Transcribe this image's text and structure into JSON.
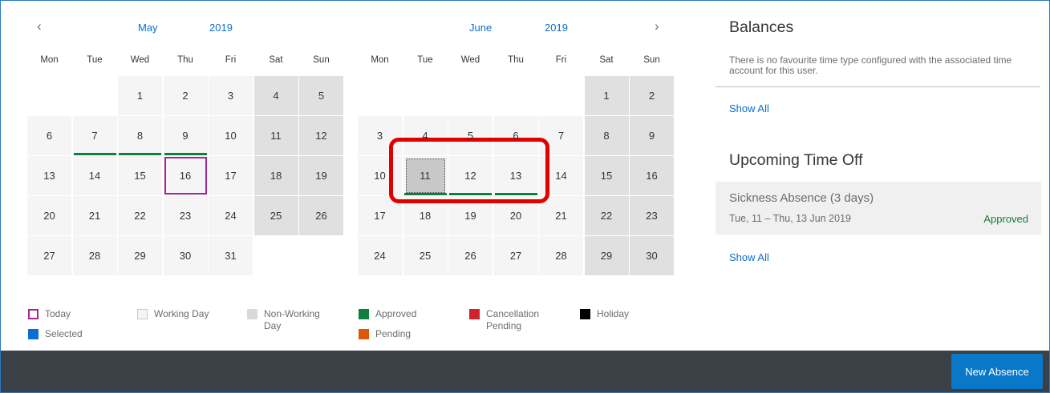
{
  "calendar_left": {
    "prev_icon": "chevron-left-icon",
    "month": "May",
    "year": "2019",
    "weekdays": [
      "Mon",
      "Tue",
      "Wed",
      "Thu",
      "Fri",
      "Sat",
      "Sun"
    ],
    "days": [
      {
        "n": "1",
        "type": "work"
      },
      {
        "n": "2",
        "type": "work"
      },
      {
        "n": "3",
        "type": "work"
      },
      {
        "n": "4",
        "type": "nonwork"
      },
      {
        "n": "5",
        "type": "nonwork"
      },
      {
        "n": "6",
        "type": "work"
      },
      {
        "n": "7",
        "type": "work",
        "status": "approved"
      },
      {
        "n": "8",
        "type": "work",
        "status": "approved"
      },
      {
        "n": "9",
        "type": "work",
        "status": "approved"
      },
      {
        "n": "10",
        "type": "work"
      },
      {
        "n": "11",
        "type": "nonwork"
      },
      {
        "n": "12",
        "type": "nonwork"
      },
      {
        "n": "13",
        "type": "work"
      },
      {
        "n": "14",
        "type": "work"
      },
      {
        "n": "15",
        "type": "work"
      },
      {
        "n": "16",
        "type": "work",
        "today": true
      },
      {
        "n": "17",
        "type": "work"
      },
      {
        "n": "18",
        "type": "nonwork"
      },
      {
        "n": "19",
        "type": "nonwork"
      },
      {
        "n": "20",
        "type": "work"
      },
      {
        "n": "21",
        "type": "work"
      },
      {
        "n": "22",
        "type": "work"
      },
      {
        "n": "23",
        "type": "work"
      },
      {
        "n": "24",
        "type": "work"
      },
      {
        "n": "25",
        "type": "nonwork"
      },
      {
        "n": "26",
        "type": "nonwork"
      },
      {
        "n": "27",
        "type": "work"
      },
      {
        "n": "28",
        "type": "work"
      },
      {
        "n": "29",
        "type": "work"
      },
      {
        "n": "30",
        "type": "work"
      },
      {
        "n": "31",
        "type": "work"
      }
    ]
  },
  "calendar_right": {
    "next_icon": "chevron-right-icon",
    "month": "June",
    "year": "2019",
    "weekdays": [
      "Mon",
      "Tue",
      "Wed",
      "Thu",
      "Fri",
      "Sat",
      "Sun"
    ],
    "days": [
      {
        "n": "1",
        "type": "nonwork"
      },
      {
        "n": "2",
        "type": "nonwork"
      },
      {
        "n": "3",
        "type": "work"
      },
      {
        "n": "4",
        "type": "work"
      },
      {
        "n": "5",
        "type": "work"
      },
      {
        "n": "6",
        "type": "work"
      },
      {
        "n": "7",
        "type": "work"
      },
      {
        "n": "8",
        "type": "nonwork"
      },
      {
        "n": "9",
        "type": "nonwork"
      },
      {
        "n": "10",
        "type": "work"
      },
      {
        "n": "11",
        "type": "work",
        "status": "approved",
        "selected": true
      },
      {
        "n": "12",
        "type": "work",
        "status": "approved"
      },
      {
        "n": "13",
        "type": "work",
        "status": "approved"
      },
      {
        "n": "14",
        "type": "work"
      },
      {
        "n": "15",
        "type": "nonwork"
      },
      {
        "n": "16",
        "type": "nonwork"
      },
      {
        "n": "17",
        "type": "work"
      },
      {
        "n": "18",
        "type": "work"
      },
      {
        "n": "19",
        "type": "work"
      },
      {
        "n": "20",
        "type": "work"
      },
      {
        "n": "21",
        "type": "work"
      },
      {
        "n": "22",
        "type": "nonwork"
      },
      {
        "n": "23",
        "type": "nonwork"
      },
      {
        "n": "24",
        "type": "work"
      },
      {
        "n": "25",
        "type": "work"
      },
      {
        "n": "26",
        "type": "work"
      },
      {
        "n": "27",
        "type": "work"
      },
      {
        "n": "28",
        "type": "work"
      },
      {
        "n": "29",
        "type": "nonwork"
      },
      {
        "n": "30",
        "type": "nonwork"
      }
    ]
  },
  "legend": [
    {
      "label": "Today",
      "color": "#a72495",
      "kind": "outline"
    },
    {
      "label": "Selected",
      "color": "#0a6ed1",
      "kind": "fill"
    },
    {
      "label": "Working Day",
      "color": "#f5f5f5",
      "kind": "fill"
    },
    {
      "label": "Non-Working Day",
      "color": "#d9d9d9",
      "kind": "fill"
    },
    {
      "label": "Approved",
      "color": "#107e3e",
      "kind": "fill"
    },
    {
      "label": "Pending",
      "color": "#d9580b",
      "kind": "fill"
    },
    {
      "label": "Cancellation Pending",
      "color": "#d3202e",
      "kind": "fill"
    },
    {
      "label": "Holiday",
      "color": "#000000",
      "kind": "fill"
    }
  ],
  "balances": {
    "title": "Balances",
    "message": "There is no favourite time type configured with the associated time account for this user.",
    "show_all": "Show All"
  },
  "upcoming": {
    "title": "Upcoming Time Off",
    "item_title": "Sickness Absence (3 days)",
    "item_dates": "Tue, 11 – Thu, 13 Jun 2019",
    "item_status": "Approved",
    "show_all": "Show All"
  },
  "footer": {
    "new_absence": "New Absence"
  }
}
